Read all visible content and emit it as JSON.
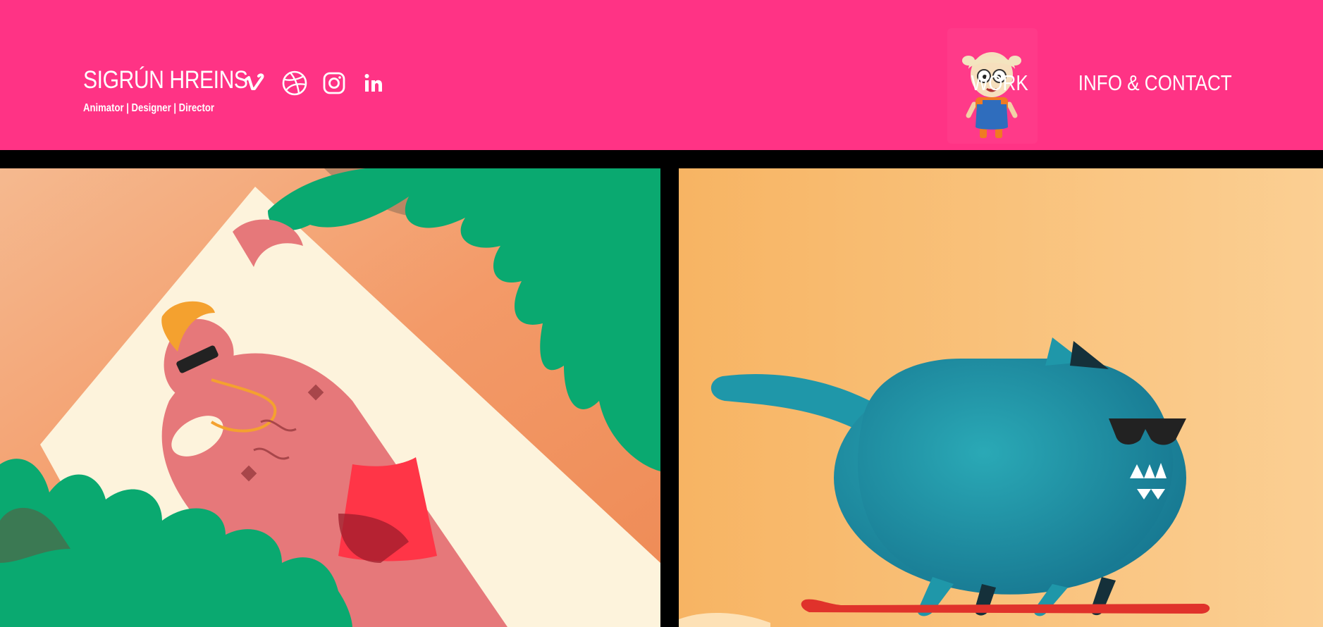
{
  "header": {
    "name": "SIGRÚN HREINS",
    "tagline": "Animator | Designer | Director",
    "background_color": "#ff3385",
    "socials": [
      {
        "icon": "vimeo-icon"
      },
      {
        "icon": "dribbble-icon"
      },
      {
        "icon": "instagram-icon"
      },
      {
        "icon": "linkedin-icon"
      }
    ],
    "avatar": "character-avatar",
    "nav": [
      {
        "label": "WORK"
      },
      {
        "label": "INFO & CONTACT"
      }
    ]
  },
  "portfolio": [
    {
      "name": "sunbather-illustration"
    },
    {
      "name": "surfing-cat-illustration"
    }
  ]
}
